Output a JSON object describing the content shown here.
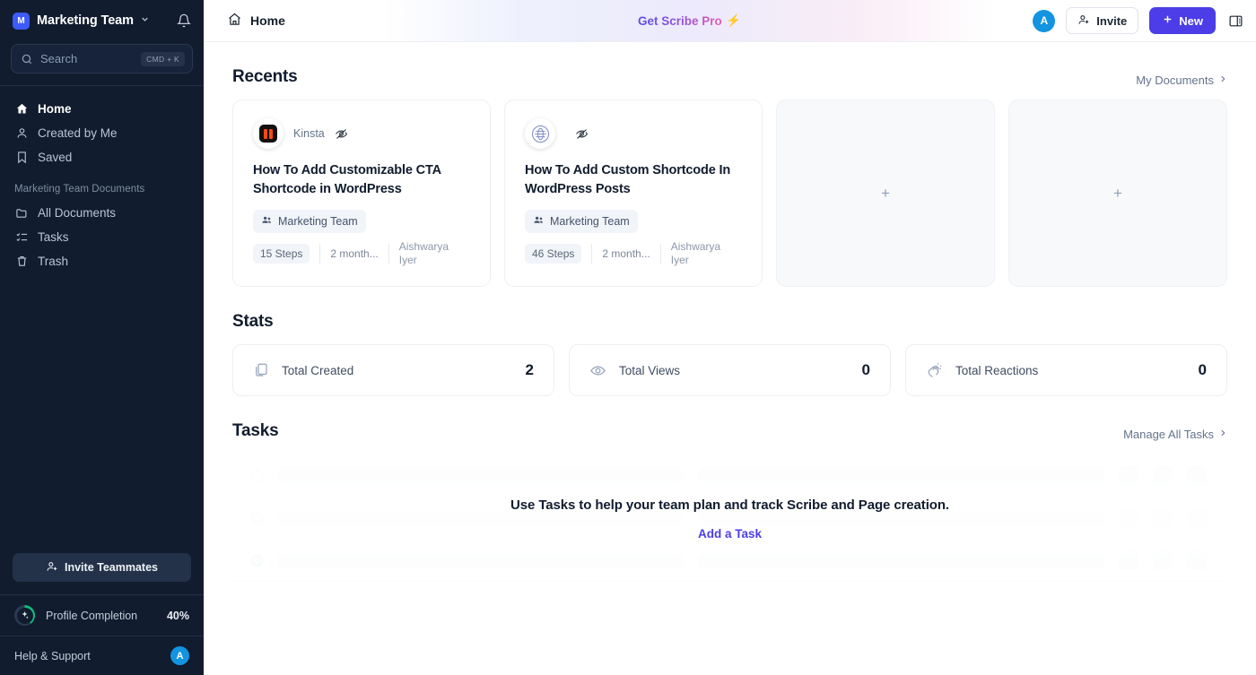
{
  "sidebar": {
    "workspace": {
      "badge": "M",
      "name": "Marketing Team",
      "chevron": "∨"
    },
    "search": {
      "placeholder": "Search",
      "shortcut": "CMD + K"
    },
    "nav": [
      {
        "label": "Home",
        "icon": "home-icon"
      },
      {
        "label": "Created by Me",
        "icon": "user-icon"
      },
      {
        "label": "Saved",
        "icon": "bookmark-icon"
      }
    ],
    "section_label": "Marketing Team Documents",
    "docs_nav": [
      {
        "label": "All Documents",
        "icon": "folder-icon"
      },
      {
        "label": "Tasks",
        "icon": "checklist-icon"
      },
      {
        "label": "Trash",
        "icon": "trash-icon"
      }
    ],
    "invite_teammates": "Invite Teammates",
    "profile": {
      "label": "Profile Completion",
      "percent": "40%"
    },
    "help": {
      "label": "Help & Support",
      "avatar": "A"
    }
  },
  "topbar": {
    "breadcrumb": "Home",
    "promo": {
      "text": "Get Scribe Pro",
      "bolt": "⚡"
    },
    "avatar": "A",
    "invite_label": "Invite",
    "new_label": "New",
    "new_plus": "+"
  },
  "recents": {
    "title": "Recents",
    "link": "My Documents",
    "chevron": "›",
    "cards": [
      {
        "logo": "kinsta-logo",
        "source": "Kinsta",
        "title": "How To Add Customizable CTA Shortcode in WordPress",
        "team": "Marketing Team",
        "steps": "15 Steps",
        "age": "2 month...",
        "author": "Aishwarya Iyer"
      },
      {
        "logo": "globe-logo",
        "source": "",
        "title": "How To Add Custom Shortcode In WordPress Posts",
        "team": "Marketing Team",
        "steps": "46 Steps",
        "age": "2 month...",
        "author": "Aishwarya Iyer"
      }
    ],
    "empty_cards": [
      {
        "plus": "+"
      },
      {
        "plus": "+"
      }
    ]
  },
  "stats": {
    "title": "Stats",
    "items": [
      {
        "label": "Total Created",
        "value": "2",
        "icon": "copy-icon"
      },
      {
        "label": "Total Views",
        "value": "0",
        "icon": "eye-icon"
      },
      {
        "label": "Total Reactions",
        "value": "0",
        "icon": "clap-icon"
      }
    ]
  },
  "tasks": {
    "title": "Tasks",
    "link": "Manage All Tasks",
    "chevron": "›",
    "empty_message": "Use Tasks to help your team plan and track Scribe and Page creation.",
    "cta": "Add a Task"
  },
  "colors": {
    "sidebar_bg": "#111c2e",
    "accent": "#4c3de8",
    "avatar": "#1294e0",
    "progress": "#0bbf7e",
    "kinsta_orange": "#fe4813"
  }
}
